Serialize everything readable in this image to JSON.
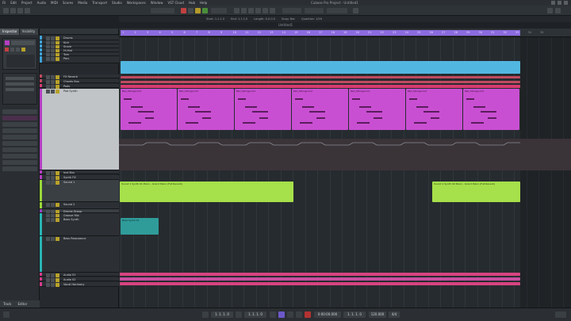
{
  "menu": [
    "Fil",
    "Edit",
    "Project",
    "Audio",
    "MIDI",
    "Scores",
    "Media",
    "Transport",
    "Studio",
    "Workspaces",
    "Window",
    "VST Cloud",
    "Hub",
    "Help"
  ],
  "window_title": "Cubase Pro Project - Untitled1",
  "info_line": [
    "Start: 1.1.1.0",
    "End: 1.1.1.0",
    "Length: 0.0.0.0",
    "Snap: Bar",
    "Quantize: 1/16"
  ],
  "project_title": "Untitled1",
  "inspector": {
    "tabs": [
      "Inspector",
      "Visibility"
    ],
    "bottom_tabs": [
      "Track",
      "Editor"
    ]
  },
  "tracks": [
    {
      "name": "Drums",
      "color": "#3fa2d6"
    },
    {
      "name": "Kick",
      "color": "#3fa2d6"
    },
    {
      "name": "Snare",
      "color": "#3fa2d6"
    },
    {
      "name": "Hi-Hat",
      "color": "#3fa2d6"
    },
    {
      "name": "Tom",
      "color": "#3fa2d6"
    },
    {
      "name": "Perc",
      "color": "#3fa2d6"
    },
    {
      "name": "FX Reverb",
      "color": "#c04a60"
    },
    {
      "name": "Chords Bus",
      "color": "#c04a60"
    },
    {
      "name": "Pads",
      "color": "#d63b6f"
    },
    {
      "name": "Pad Synth",
      "color": "#b43fc2"
    },
    {
      "name": "Inst Bus",
      "color": "#b43fc2"
    },
    {
      "name": "Synth FX",
      "color": "#b43fc2"
    },
    {
      "name": "Sound 1",
      "color": "#9ad83a"
    },
    {
      "name": "Sound 2",
      "color": "#9ad83a"
    },
    {
      "name": "Drums Group",
      "color": "#9b3fc2"
    },
    {
      "name": "Groove Mix",
      "color": "#2ab5b5"
    },
    {
      "name": "Bass Synth",
      "color": "#2ab5b5"
    },
    {
      "name": "Bass Resonance",
      "color": "#2ab5b5"
    },
    {
      "name": "Audio 01",
      "color": "#d63b8c"
    },
    {
      "name": "Audio 02",
      "color": "#d63b8c"
    },
    {
      "name": "Vocal Harmony",
      "color": "#d63b8c"
    }
  ],
  "ruler_ticks": [
    "1",
    "2",
    "3",
    "4",
    "5",
    "6",
    "7",
    "8",
    "9",
    "10",
    "11",
    "12",
    "13",
    "14",
    "15",
    "16",
    "17",
    "18",
    "19",
    "20",
    "21",
    "22",
    "23",
    "24",
    "25",
    "26",
    "27",
    "28",
    "29",
    "30",
    "31",
    "32",
    "33",
    "34",
    "35"
  ],
  "clips": {
    "pad_labels": [
      "Pad_Strings.mid",
      "Pad_Strings.mid",
      "Pad_Strings.mid",
      "Pad_Strings.mid",
      "Pad_Strings.mid",
      "Pad_Strings.mid",
      "Pad_Strings.mid"
    ],
    "sound1_a": "Sound 1 Synth 01 Piano - Grand Piano (Full Reverb)",
    "sound1_b": "Sound 1 Synth 02 Piano - Grand Piano (Full Reverb)",
    "bass": "Bass Synth 01"
  },
  "transport": {
    "left_locator": "1. 1. 1. 0",
    "right_locator": "1. 1. 1. 0",
    "position": "0:00:00.000",
    "bar_position": "1. 1. 1. 0",
    "tempo": "120.000",
    "signature": "4/4"
  }
}
